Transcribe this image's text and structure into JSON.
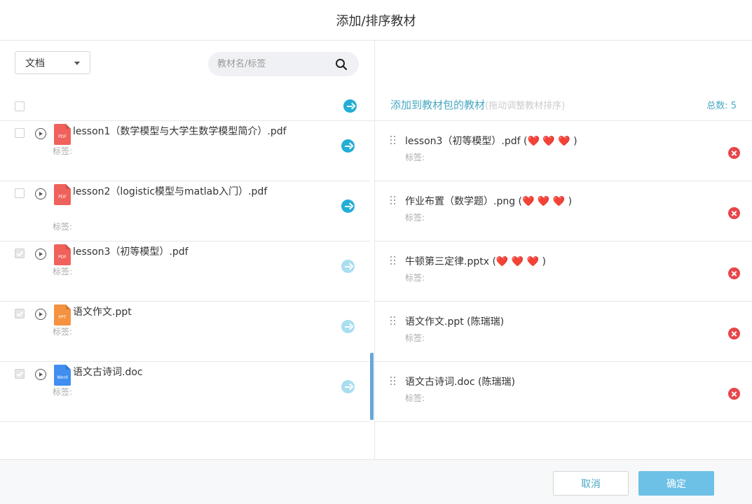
{
  "dialog": {
    "title": "添加/排序教材"
  },
  "left": {
    "filter": {
      "selected": "文档"
    },
    "search": {
      "placeholder": "教材名/标签"
    },
    "items": [
      {
        "name": "lesson1（数学模型与大学生数学模型简介）.pdf",
        "tag": "标签:",
        "type": "pdf",
        "type_label": "PDF",
        "checked": false,
        "added": false
      },
      {
        "name": "lesson2（logistic模型与matlab入门）.pdf",
        "tag": "标签:",
        "type": "pdf",
        "type_label": "PDF",
        "checked": false,
        "added": false
      },
      {
        "name": "lesson3（初等模型）.pdf",
        "tag": "标签:",
        "type": "pdf",
        "type_label": "PDF",
        "checked": true,
        "added": true
      },
      {
        "name": "语文作文.ppt",
        "tag": "标签:",
        "type": "ppt",
        "type_label": "PPT",
        "checked": true,
        "added": true
      },
      {
        "name": "语文古诗词.doc",
        "tag": "标签:",
        "type": "doc",
        "type_label": "Word",
        "checked": true,
        "added": true
      }
    ]
  },
  "right": {
    "title": "添加到教材包的教材",
    "hint": "(拖动调整教材排序)",
    "total_label": "总数:",
    "total": "5",
    "items": [
      {
        "name": "lesson3（初等模型）.pdf (❤️ ❤️ ❤️ )",
        "tag": "标签:"
      },
      {
        "name": "作业布置（数学题）.png (❤️ ❤️ ❤️ )",
        "tag": "标签:"
      },
      {
        "name": "牛顿第三定律.pptx (❤️ ❤️ ❤️ )",
        "tag": "标签:"
      },
      {
        "name": "语文作文.ppt (陈瑞瑞)",
        "tag": "标签:"
      },
      {
        "name": "语文古诗词.doc (陈瑞瑞)",
        "tag": "标签:"
      }
    ]
  },
  "footer": {
    "cancel": "取消",
    "confirm": "确定"
  },
  "colors": {
    "accent": "#22aed6",
    "accent_light": "#6dc1e6",
    "delete": "#e8454a",
    "pdf": "#f0615b",
    "ppt": "#f5923f",
    "doc": "#3f8ef0"
  }
}
